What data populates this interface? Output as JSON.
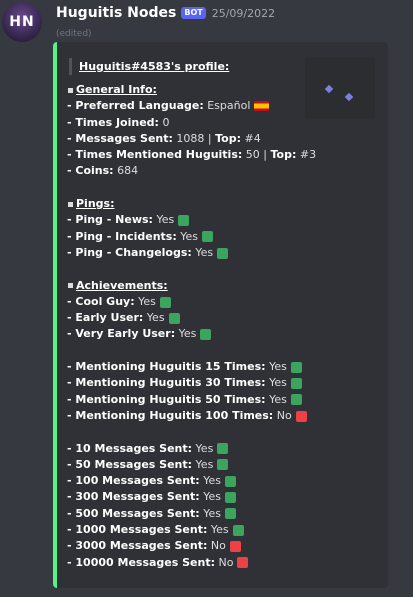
{
  "message": {
    "avatar_initials": "HN",
    "username": "Huguitis Nodes",
    "bot_tag": "BOT",
    "timestamp": "25/09/2022",
    "edited": "(edited)"
  },
  "embed": {
    "accent_color": "#57f287",
    "title": "Huguitis#4583's profile:",
    "general_header": "General Info:",
    "language_label": "- Preferred Language:",
    "language_value": "Español",
    "times_joined_label": "- Times Joined:",
    "times_joined_value": "0",
    "messages_sent_label": "- Messages Sent:",
    "messages_sent_value": "1088",
    "top_label": "Top:",
    "messages_top_value": "#4",
    "mentioned_label": "- Times Mentioned Huguitis:",
    "mentioned_value": "50",
    "mentioned_top_value": "#3",
    "coins_label": "- Coins:",
    "coins_value": "684",
    "pings_header": "Pings:",
    "achievements_header": "Achievements:",
    "pings": [
      {
        "label": "- Ping - News:",
        "value": "Yes",
        "ok": true
      },
      {
        "label": "- Ping - Incidents:",
        "value": "Yes",
        "ok": true
      },
      {
        "label": "- Ping - Changelogs:",
        "value": "Yes",
        "ok": true
      }
    ],
    "achievements": [
      {
        "label": "- Cool Guy:",
        "value": "Yes",
        "ok": true
      },
      {
        "label": "- Early User:",
        "value": "Yes",
        "ok": true
      },
      {
        "label": "- Very Early User:",
        "value": "Yes",
        "ok": true
      }
    ],
    "mentions": [
      {
        "label": "- Mentioning Huguitis 15 Times:",
        "value": "Yes",
        "ok": true
      },
      {
        "label": "- Mentioning Huguitis 30 Times:",
        "value": "Yes",
        "ok": true
      },
      {
        "label": "- Mentioning Huguitis 50 Times:",
        "value": "Yes",
        "ok": true
      },
      {
        "label": "- Mentioning Huguitis 100 Times:",
        "value": "No",
        "ok": false
      }
    ],
    "messages": [
      {
        "label": "- 10 Messages Sent:",
        "value": "Yes",
        "ok": true
      },
      {
        "label": "- 50 Messages Sent:",
        "value": "Yes",
        "ok": true
      },
      {
        "label": "- 100 Messages Sent:",
        "value": "Yes",
        "ok": true
      },
      {
        "label": "- 300 Messages Sent:",
        "value": "Yes",
        "ok": true
      },
      {
        "label": "- 500 Messages Sent:",
        "value": "Yes",
        "ok": true
      },
      {
        "label": "- 1000 Messages Sent:",
        "value": "Yes",
        "ok": true
      },
      {
        "label": "- 3000 Messages Sent:",
        "value": "No",
        "ok": false
      },
      {
        "label": "- 10000 Messages Sent:",
        "value": "No",
        "ok": false
      }
    ]
  }
}
